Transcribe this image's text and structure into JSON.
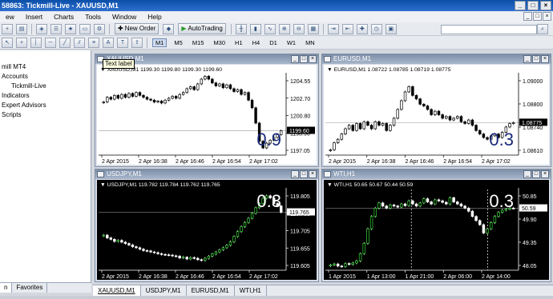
{
  "window": {
    "title": "58863: Tickmill-Live - XAUUSD,M1"
  },
  "menu": [
    "ew",
    "Insert",
    "Charts",
    "Tools",
    "Window",
    "Help"
  ],
  "toolbar": {
    "new_order": "New Order",
    "autotrading": "AutoTrading",
    "timeframes": [
      "M1",
      "M5",
      "M15",
      "M30",
      "H1",
      "H4",
      "D1",
      "W1",
      "MN"
    ],
    "selected_timeframe": "M1"
  },
  "navigator": {
    "root": "mill MT4",
    "items": [
      "Accounts",
      "Tickmill-Live",
      "Indicators",
      "Expert Advisors",
      "Scripts"
    ],
    "tabs": [
      "n",
      "Favorites"
    ]
  },
  "tooltip": "Text label",
  "doc_tabs": [
    "XAUUSD,M1",
    "USDJPY,M1",
    "EURUSD,M1",
    "WTI,H1"
  ],
  "charts": [
    {
      "window_title": "XAUUSD,M1",
      "info": "XAUUSD,M1  1199.30 1199.80 1199.30 1199.60",
      "big_label": "0.9",
      "price_label": "1199.60",
      "y_ticks": [
        "1204.55",
        "1202.70",
        "1200.80",
        "1198.90",
        "1197.05"
      ],
      "x_ticks": [
        "2 Apr 2015",
        "2 Apr 16:38",
        "2 Apr 16:46",
        "2 Apr 16:54",
        "2 Apr 17:02"
      ],
      "theme": "light",
      "ymin": 1197.05,
      "ymax": 1205.5,
      "data": [
        1202.6,
        1203.1,
        1202.9,
        1203.3,
        1203.0,
        1203.4,
        1203.1,
        1203.5,
        1203.2,
        1203.6,
        1203.3,
        1203.1,
        1202.9,
        1202.8,
        1202.6,
        1202.7,
        1202.5,
        1202.8,
        1203.0,
        1203.2,
        1203.0,
        1203.4,
        1203.6,
        1204.0,
        1204.2,
        1203.9,
        1204.5,
        1205.0,
        1205.3,
        1205.0,
        1204.6,
        1204.3,
        1204.5,
        1204.1,
        1204.4,
        1204.0,
        1203.7,
        1203.9,
        1203.4,
        1203.6,
        1202.8,
        1202.0,
        1200.4,
        1198.5,
        1197.8,
        1198.3,
        1198.6,
        1198.9,
        1199.2,
        1199.6
      ],
      "hline": 1199.6,
      "vlines": []
    },
    {
      "window_title": "EURUSD,M1",
      "info": "EURUSD,M1  1.08722 1.08785 1.08719 1.08775",
      "big_label": "0.3",
      "price_label": "1.08775",
      "y_ticks": [
        "1.09000",
        "1.08800",
        "1.08740",
        "1.08610"
      ],
      "x_ticks": [
        "2 Apr 2015",
        "2 Apr 16:38",
        "2 Apr 16:46",
        "2 Apr 16:54",
        "2 Apr 17:02"
      ],
      "theme": "light",
      "ymin": 1.0859,
      "ymax": 1.0905,
      "data": [
        1.0862,
        1.0866,
        1.0868,
        1.0871,
        1.0874,
        1.0876,
        1.0873,
        1.0877,
        1.0874,
        1.0878,
        1.0876,
        1.0874,
        1.0878,
        1.0876,
        1.0877,
        1.0873,
        1.0876,
        1.088,
        1.0885,
        1.089,
        1.0895,
        1.0898,
        1.0893,
        1.0891,
        1.0888,
        1.0887,
        1.0885,
        1.0882,
        1.0884,
        1.0882,
        1.088,
        1.0881,
        1.0879,
        1.088,
        1.0881,
        1.0878,
        1.0877,
        1.0879,
        1.0876,
        1.0873,
        1.0871,
        1.0869,
        1.0868,
        1.087,
        1.0871,
        1.0869,
        1.0872,
        1.0875,
        1.0877,
        1.08775
      ],
      "hline": 1.08775,
      "vlines": []
    },
    {
      "window_title": "USDJPY,M1",
      "info": "USDJPY,M1  119.782 119.784 119.762 119.765",
      "big_label": "0.3",
      "price_label": "119.765",
      "y_ticks": [
        "119.805",
        "119.765",
        "119.705",
        "119.655",
        "119.605"
      ],
      "x_ticks": [
        "2 Apr 2015",
        "2 Apr 16:38",
        "2 Apr 16:46",
        "2 Apr 16:54",
        "2 Apr 17:02"
      ],
      "theme": "dark",
      "ymin": 119.6,
      "ymax": 119.83,
      "data": [
        119.7,
        119.692,
        119.688,
        119.682,
        119.685,
        119.68,
        119.676,
        119.672,
        119.667,
        119.664,
        119.66,
        119.656,
        119.655,
        119.652,
        119.65,
        119.647,
        119.645,
        119.644,
        119.643,
        119.641,
        119.64,
        119.635,
        119.637,
        119.632,
        119.636,
        119.634,
        119.63,
        119.628,
        119.634,
        119.64,
        119.646,
        119.652,
        119.658,
        119.664,
        119.671,
        119.681,
        119.696,
        119.71,
        119.724,
        119.736,
        119.748,
        119.762,
        119.778,
        119.79,
        119.805,
        119.812,
        119.806,
        119.79,
        119.783,
        119.765
      ],
      "hline": 119.765,
      "vlines": []
    },
    {
      "window_title": "WTI,H1",
      "info": "WTI,H1  50.65 50.67 50.44 50.59",
      "big_label": "0.3",
      "price_label": "50.59",
      "y_ticks": [
        "50.85",
        "49.90",
        "49.35",
        "48.05"
      ],
      "x_ticks": [
        "1 Apr 2015",
        "1 Apr 13:00",
        "1 Apr 21:00",
        "2 Apr 06:00",
        "2 Apr 14:00"
      ],
      "theme": "dark",
      "ymin": 47.6,
      "ymax": 51.5,
      "data": [
        47.85,
        47.9,
        47.8,
        47.78,
        47.92,
        47.88,
        47.95,
        48.05,
        48.4,
        48.9,
        49.6,
        50.2,
        50.6,
        50.85,
        50.7,
        50.6,
        50.75,
        50.7,
        50.65,
        50.8,
        50.72,
        50.95,
        50.8,
        50.7,
        50.85,
        51.05,
        50.9,
        50.8,
        51.0,
        50.95,
        50.88,
        50.8,
        51.1,
        50.9,
        50.8,
        50.7,
        50.6,
        50.45,
        50.2,
        50.0,
        49.8,
        49.4,
        49.6,
        49.9,
        50.2,
        50.4,
        50.5,
        50.55,
        50.6,
        50.59
      ],
      "hline": 50.59,
      "vlines": [
        0.445,
        0.84
      ]
    }
  ]
}
